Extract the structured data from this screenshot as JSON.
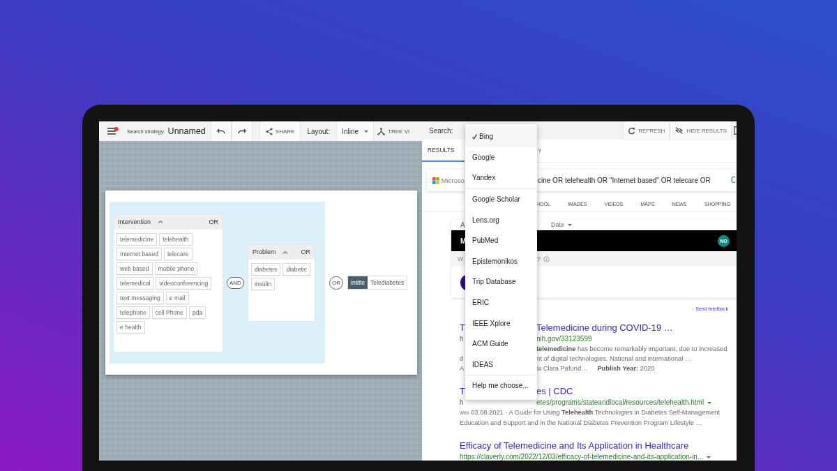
{
  "strategy_editor": {
    "toolbar": {
      "strategy_label": "Search strategy:",
      "strategy_name": "Unnamed",
      "share": "SHARE",
      "layout_label": "Layout:",
      "layout_value": "Inline",
      "tree_view": "TREE VI"
    },
    "query": {
      "groups": [
        {
          "title": "Intervention",
          "operator": "OR",
          "expanded": true,
          "terms": [
            "telemedicine",
            "telehealth",
            "Internet based",
            "telecare",
            "web based",
            "mobile phone",
            "telemedical",
            "videoconferencing",
            "text messaging",
            "e mail",
            "telephone",
            "cell Phone",
            "pda",
            "e health"
          ]
        },
        {
          "title": "Problem",
          "operator": "OR",
          "expanded": true,
          "terms": [
            "diabetes",
            "diabetic",
            "insulin"
          ]
        }
      ],
      "joiner": "AND",
      "extra_operator": "OR",
      "field_tag": {
        "field": "intitle",
        "term": "Telediabetes"
      }
    }
  },
  "results_panel": {
    "search_label": "Search:",
    "buttons": [
      {
        "kind": "refresh",
        "label": "REFRESH"
      },
      {
        "kind": "hide",
        "label": "HIDE RESULTS"
      }
    ],
    "tabs": [
      {
        "label": "RESULTS",
        "selected": true
      },
      {
        "label": "Y",
        "selected": false
      }
    ],
    "engine_menu": {
      "groups": [
        {
          "items": [
            {
              "label": "Bing",
              "selected": true
            },
            {
              "label": "Google",
              "selected": false
            },
            {
              "label": "Yandex",
              "selected": false
            }
          ]
        },
        {
          "items": [
            {
              "label": "Google Scholar",
              "selected": false
            },
            {
              "label": "Lens.org",
              "selected": false
            },
            {
              "label": "PubMed",
              "selected": false
            },
            {
              "label": "Epistemonikos",
              "selected": false
            },
            {
              "label": "Trip Database",
              "selected": false
            },
            {
              "label": "ERIC",
              "selected": false
            },
            {
              "label": "IEEE Xplore",
              "selected": false
            },
            {
              "label": "ACM Guide",
              "selected": false
            },
            {
              "label": "IDEAS",
              "selected": false
            }
          ]
        },
        {
          "items": [
            {
              "label": "Help me choose...",
              "selected": false
            }
          ]
        }
      ]
    },
    "bing": {
      "logo_text": "Microso",
      "query": "cine OR telehealth OR \"Internet based\" OR telecare OR",
      "nav": [
        "HOOL",
        "IMAGES",
        "VIDEOS",
        "MAPS",
        "NEWS",
        "SHOPPING"
      ],
      "filter_left": "A",
      "filter_date": "Date",
      "banner_left": "M",
      "banner_badge": "NO",
      "prompt_left": "W",
      "prompt_right": "?",
      "feedback": "Send feedback",
      "results": [
        {
          "title_left": "T",
          "title": "Telemedicine during COVID-19 …",
          "url_left": "h",
          "url": "nih.gov/33123599",
          "url_menu": false,
          "lines": [
            {
              "text": "**telemedicine** has become remarkably important, due to increased"
            },
            {
              "left": "d",
              "text": "nt of digital technologies. National and international …"
            }
          ],
          "meta_left": "A",
          "meta": [
            "ia Clara Pafund…",
            "**Publish Year:** 2020"
          ]
        },
        {
          "title_left": "T",
          "title": "es | CDC",
          "url_left": "h",
          "url": "etes/programs/stateandlocal/resources/telehealth.html",
          "url_menu": true,
          "snippet_label": "Web",
          "snippet": "03.08.2021 · A Guide for Using **Telehealth** Technologies in Diabetes Self-Management Education and Support and in the National Diabetes Prevention Program Lifestyle …"
        },
        {
          "title": "Efficacy of Telemedicine and Its Application in Healthcare",
          "url": "https://claverly.com/2022/12/03/efficacy-of-telemedicine-and-its-application-in...",
          "url_menu": true
        }
      ]
    }
  }
}
